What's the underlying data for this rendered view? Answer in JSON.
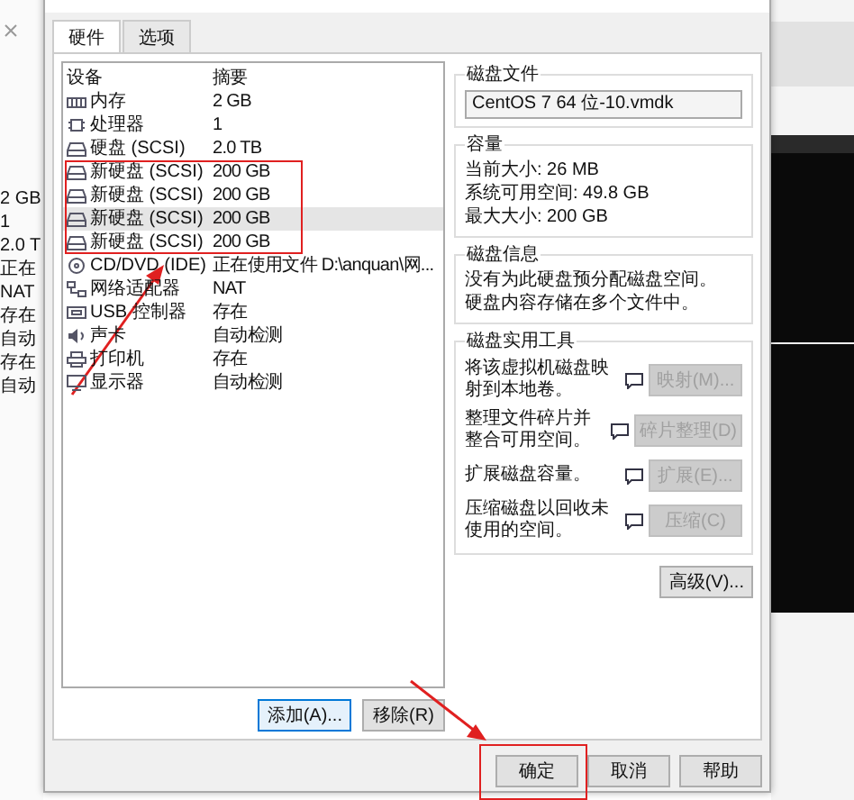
{
  "background_window": {
    "values": [
      "2 GB",
      "1",
      "2.0 T",
      "正在",
      "NAT",
      "存在",
      "自动",
      "存在",
      "自动"
    ]
  },
  "tabs": [
    {
      "label": "硬件",
      "selected": true
    },
    {
      "label": "选项",
      "selected": false
    }
  ],
  "device_list": {
    "columns": [
      "设备",
      "摘要"
    ],
    "rows": [
      {
        "kind": "memory",
        "device": "内存",
        "summary": "2 GB",
        "selected": false
      },
      {
        "kind": "cpu",
        "device": "处理器",
        "summary": "1",
        "selected": false
      },
      {
        "kind": "disk",
        "device": "硬盘 (SCSI)",
        "summary": "2.0 TB",
        "selected": false
      },
      {
        "kind": "disk",
        "device": "新硬盘 (SCSI)",
        "summary": "200 GB",
        "selected": false
      },
      {
        "kind": "disk",
        "device": "新硬盘 (SCSI)",
        "summary": "200 GB",
        "selected": false
      },
      {
        "kind": "disk",
        "device": "新硬盘 (SCSI)",
        "summary": "200 GB",
        "selected": true
      },
      {
        "kind": "disk",
        "device": "新硬盘 (SCSI)",
        "summary": "200 GB",
        "selected": false
      },
      {
        "kind": "cd",
        "device": "CD/DVD (IDE)",
        "summary": "正在使用文件 D:\\anquan\\网...",
        "selected": false
      },
      {
        "kind": "network",
        "device": "网络适配器",
        "summary": "NAT",
        "selected": false
      },
      {
        "kind": "usb",
        "device": "USB 控制器",
        "summary": "存在",
        "selected": false
      },
      {
        "kind": "sound",
        "device": "声卡",
        "summary": "自动检测",
        "selected": false
      },
      {
        "kind": "printer",
        "device": "打印机",
        "summary": "存在",
        "selected": false
      },
      {
        "kind": "display",
        "device": "显示器",
        "summary": "自动检测",
        "selected": false
      }
    ],
    "buttons": [
      "添加(A)...",
      "移除(R)"
    ]
  },
  "disk_file": {
    "title": "磁盘文件",
    "value": "CentOS 7 64 位-10.vmdk"
  },
  "capacity": {
    "title": "容量",
    "lines": [
      "当前大小: 26 MB",
      "系统可用空间: 49.8 GB",
      "最大大小: 200 GB"
    ]
  },
  "disk_info": {
    "title": "磁盘信息",
    "lines": [
      "没有为此硬盘预分配磁盘空间。",
      "硬盘内容存储在多个文件中。"
    ]
  },
  "disk_tools": {
    "title": "磁盘实用工具",
    "tools": [
      {
        "description": "将该虚拟机磁盘映射到本地卷。",
        "button": "映射(M)...",
        "disabled": true
      },
      {
        "description": "整理文件碎片并整合可用空间。",
        "button": "碎片整理(D)",
        "disabled": true
      },
      {
        "description": "扩展磁盘容量。",
        "button": "扩展(E)...",
        "disabled": true
      },
      {
        "description": "压缩磁盘以回收未使用的空间。",
        "button": "压缩(C)",
        "disabled": true
      }
    ]
  },
  "advanced_button": "高级(V)...",
  "dialog_buttons": [
    "确定",
    "取消",
    "帮助"
  ]
}
